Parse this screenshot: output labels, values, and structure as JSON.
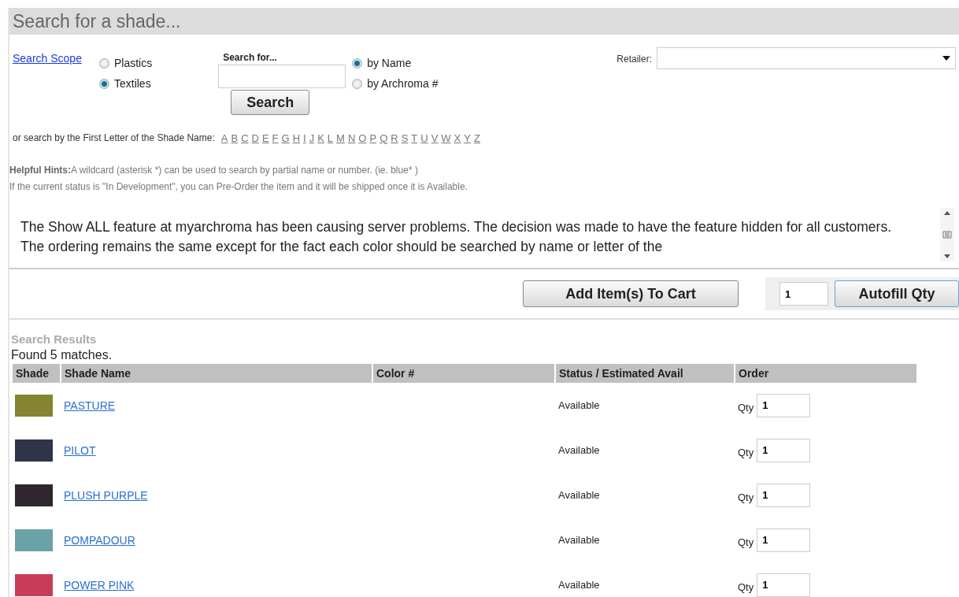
{
  "header": {
    "title": "Search for a shade..."
  },
  "search": {
    "scope_link": "Search Scope",
    "scope_options": [
      {
        "label": "Plastics",
        "selected": false
      },
      {
        "label": "Textiles",
        "selected": true
      }
    ],
    "search_for_label": "Search for...",
    "search_button": "Search",
    "by_options": [
      {
        "label": "by Name",
        "selected": true
      },
      {
        "label": "by Archroma #",
        "selected": false
      }
    ],
    "retailer_label": "Retailer:"
  },
  "letters": {
    "label": "or search by the First Letter of the Shade Name:",
    "items": [
      "A",
      "B",
      "C",
      "D",
      "E",
      "F",
      "G",
      "H",
      "I",
      "J",
      "K",
      "L",
      "M",
      "N",
      "O",
      "P",
      "Q",
      "R",
      "S",
      "T",
      "U",
      "V",
      "W",
      "X",
      "Y",
      "Z"
    ]
  },
  "hints": [
    {
      "label": "Helpful Hints:",
      "text": "A wildcard (asterisk *) can be used to search by partial name or number. (ie. blue* )"
    },
    {
      "text": "If the current status is \"In Development\", you can Pre-Order the item and it will be shipped once it is Available."
    }
  ],
  "notice": "The Show ALL feature at myarchroma has been causing server problems. The decision was made to have the feature hidden for all customers. The ordering remains the same except for the fact each color should be searched by name or letter of the",
  "actions": {
    "add_button": "Add Item(s) To Cart",
    "autofill_qty": "1",
    "autofill_button": "Autofill Qty"
  },
  "results": {
    "title": "Search Results",
    "count": "Found 5 matches.",
    "columns": [
      "Shade",
      "Shade Name",
      "Color #",
      "Status / Estimated Avail",
      "Order"
    ],
    "rows": [
      {
        "color": "#858430",
        "name": "PASTURE",
        "status": "Available",
        "qty_label": "Qty",
        "qty": "1"
      },
      {
        "color": "#2e344a",
        "name": "PILOT",
        "status": "Available",
        "qty_label": "Qty",
        "qty": "1"
      },
      {
        "color": "#30262f",
        "name": "PLUSH PURPLE",
        "status": "Available",
        "qty_label": "Qty",
        "qty": "1"
      },
      {
        "color": "#6ba2a8",
        "name": "POMPADOUR",
        "status": "Available",
        "qty_label": "Qty",
        "qty": "1"
      },
      {
        "color": "#c83c58",
        "name": "POWER PINK",
        "status": "Available",
        "qty_label": "Qty",
        "qty": "1"
      }
    ]
  }
}
